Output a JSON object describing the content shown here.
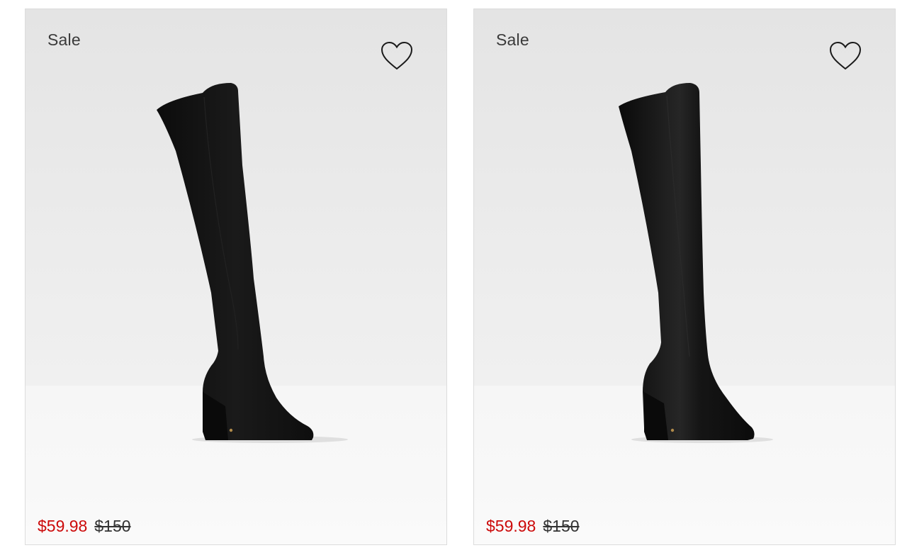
{
  "products": [
    {
      "badge": "Sale",
      "sale_price": "$59.98",
      "original_price": "$150",
      "wishlist_icon": "heart-outline-icon",
      "image": "black suede over-the-knee block heel boot"
    },
    {
      "badge": "Sale",
      "sale_price": "$59.98",
      "original_price": "$150",
      "wishlist_icon": "heart-outline-icon",
      "image": "black leather over-the-knee block heel boot"
    }
  ],
  "colors": {
    "sale_price": "#cc0a0a",
    "original_price": "#333333",
    "boot": "#141414"
  }
}
